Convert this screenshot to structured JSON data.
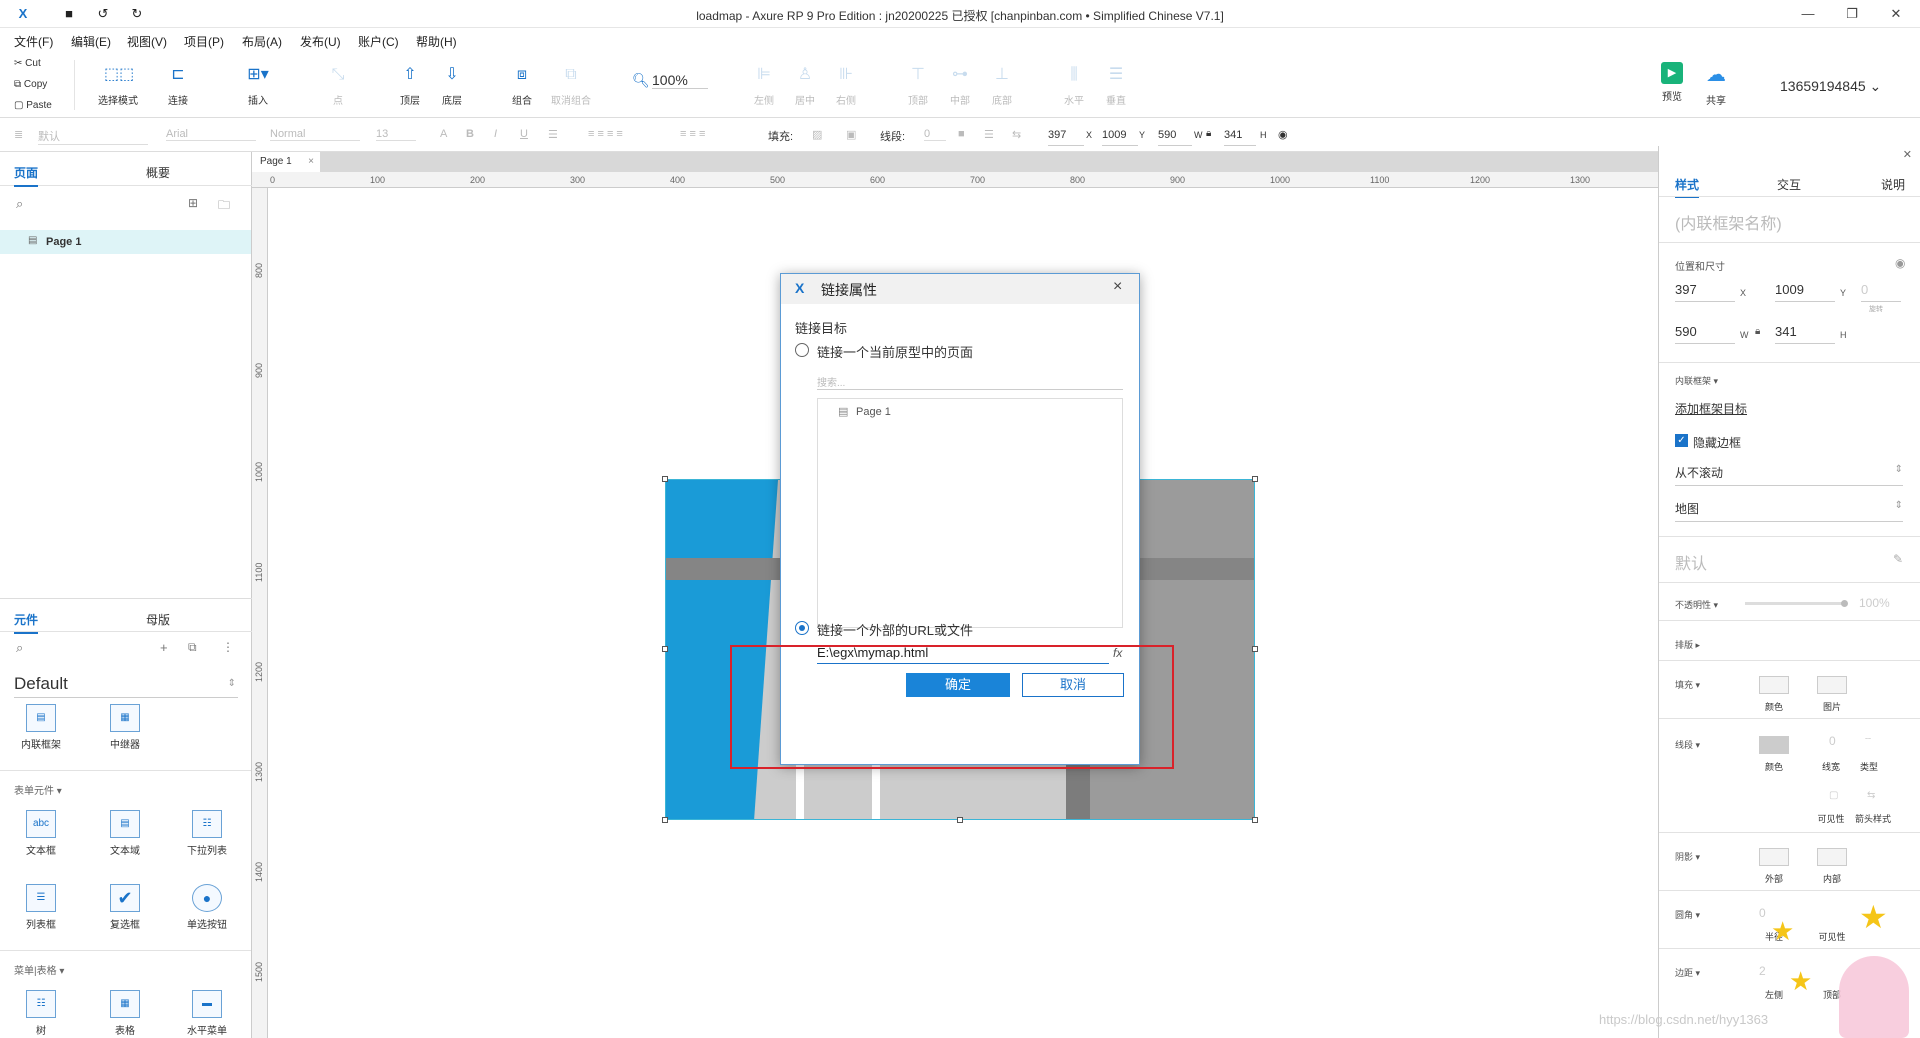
{
  "window": {
    "title": "loadmap - Axure RP 9 Pro Edition : jn20200225 已授权     [chanpinban.com • Simplified Chinese V7.1]",
    "min": "—",
    "max": "❐",
    "close": "✕"
  },
  "menu": [
    "文件(F)",
    "编辑(E)",
    "视图(V)",
    "项目(P)",
    "布局(A)",
    "发布(U)",
    "账户(C)",
    "帮助(H)"
  ],
  "clipboard": {
    "cut": "Cut",
    "copy": "Copy",
    "paste": "Paste"
  },
  "toolbar": {
    "select_mode": "选择模式",
    "connect": "连接",
    "insert": "插入",
    "point": "点",
    "top": "顶层",
    "bottom": "底层",
    "group": "组合",
    "ungroup": "取消组合",
    "zoom": "100%",
    "align_left": "左侧",
    "align_center": "居中",
    "align_right": "右侧",
    "align_top": "顶部",
    "align_middle": "中部",
    "align_bottom": "底部",
    "horizontal": "水平",
    "vertical": "垂直",
    "preview": "预览",
    "share": "共享",
    "account": "13659194845"
  },
  "format": {
    "style": "默认",
    "font": "Arial",
    "weight": "Normal",
    "size": "13",
    "fill_label": "填充:",
    "stroke_label": "线段:",
    "stroke_val": "0",
    "x": "397",
    "x_label": "X",
    "y": "1009",
    "y_label": "Y",
    "w": "590",
    "w_label": "W",
    "h": "341",
    "h_label": "H"
  },
  "left": {
    "tab_pages": "页面",
    "tab_outline": "概要",
    "page1": "Page 1",
    "tab_widgets": "元件",
    "tab_masters": "母版",
    "library": "Default",
    "w_iframe": "内联框架",
    "w_repeater": "中继器",
    "sec_form": "表单元件 ▾",
    "w_textbox": "文本框",
    "w_textarea": "文本域",
    "w_dropdown": "下拉列表",
    "w_listbox": "列表框",
    "w_checkbox": "复选框",
    "w_radio": "单选按钮",
    "sec_menu": "菜单|表格 ▾",
    "w_tree": "树",
    "w_table": "表格",
    "w_hmenu": "水平菜单",
    "abc": "abc"
  },
  "canvas": {
    "doc_tab": "Page 1",
    "ruler_h": [
      "0",
      "100",
      "200",
      "300",
      "400",
      "500",
      "600",
      "700",
      "800",
      "900",
      "1000",
      "1100",
      "1200",
      "1300"
    ],
    "ruler_v": [
      "800",
      "900",
      "1000",
      "1100",
      "1200",
      "1300",
      "1400",
      "1500"
    ]
  },
  "dialog": {
    "title": "链接属性",
    "target_label": "链接目标",
    "opt_page": "链接一个当前原型中的页面",
    "search_placeholder": "搜索...",
    "tree_page": "Page 1",
    "opt_url": "链接一个外部的URL或文件",
    "url_value": "E:\\egx\\mymap.html",
    "fx": "fx",
    "ok": "确定",
    "cancel": "取消"
  },
  "right": {
    "tab_style": "样式",
    "tab_interact": "交互",
    "tab_notes": "说明",
    "name_placeholder": "(内联框架名称)",
    "pos_label": "位置和尺寸",
    "x": "397",
    "y": "1009",
    "rot": "0",
    "w": "590",
    "h": "341",
    "x_l": "X",
    "y_l": "Y",
    "w_l": "W",
    "h_l": "H",
    "rot_l": "旋转",
    "iframe_label": "内联框架 ▾",
    "add_target": "添加框架目标",
    "hide_border": "隐藏边框",
    "scroll": "从不滚动",
    "map": "地图",
    "default_style": "默认",
    "opacity_label": "不透明性 ▾",
    "opacity": "100%",
    "typography": "排版 ▸",
    "fill": "填充 ▾",
    "fill_color": "颜色",
    "fill_image": "图片",
    "stroke": "线段 ▾",
    "stroke_color": "颜色",
    "stroke_width": "线宽",
    "stroke_type": "类型",
    "stroke_val": "0",
    "visibility": "可见性",
    "arrow": "箭头样式",
    "shadow": "阴影 ▾",
    "shadow_out": "外部",
    "shadow_in": "内部",
    "corner": "圆角 ▾",
    "corner_val": "0",
    "radius": "半径",
    "visible": "可见性",
    "padding": "边距 ▾",
    "pad_val": "2",
    "pad_left": "左侧",
    "pad_top": "顶部"
  },
  "watermark": "https://blog.csdn.net/hyy1363",
  "colors": {
    "accent": "#1a73c9",
    "selection_red": "#d9222a",
    "map_blue": "#1a9bd7"
  }
}
